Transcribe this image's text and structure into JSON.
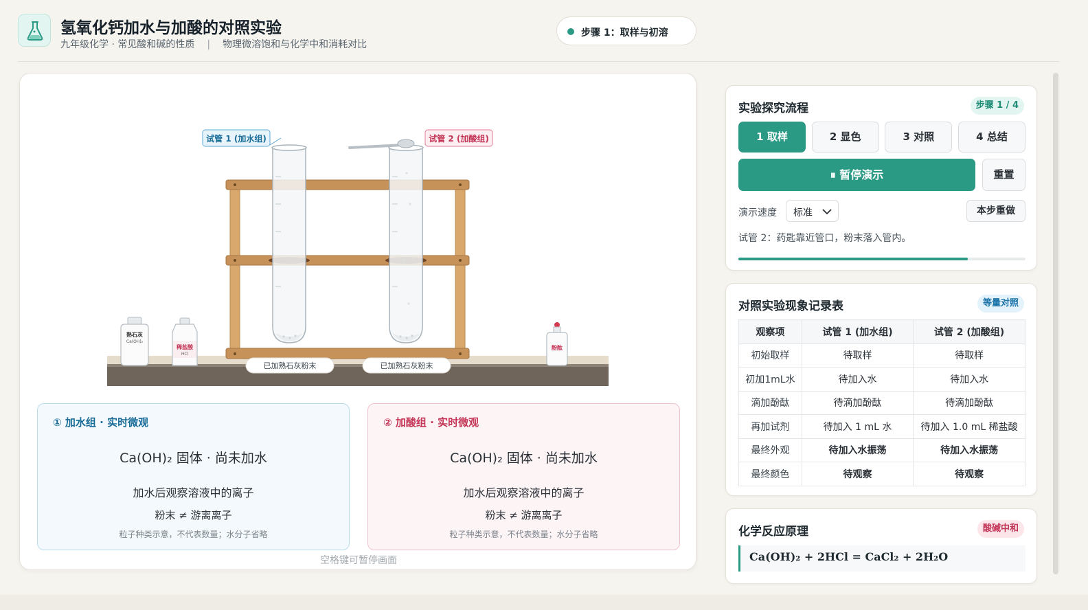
{
  "header": {
    "title": "氢氧化钙加水与加酸的对照实验",
    "subtitle_left": "九年级化学 · 常见酸和碱的性质",
    "subtitle_sep": "|",
    "subtitle_right": "物理微溶饱和与化学中和消耗对比",
    "step_pill": "步骤 1：取样与初溶",
    "icon": "flask-icon"
  },
  "stage": {
    "tube1_label": "试管 1 (加水组)",
    "tube2_label": "试管 2 (加酸组)",
    "tube1_tag": "已加熟石灰粉末",
    "tube2_tag": "已加熟石灰粉末",
    "bottle_lime_name": "熟石灰",
    "bottle_lime_formula": "Ca(OH)₂",
    "bottle_acid_name": "稀盐酸",
    "bottle_acid_formula": "HCl",
    "bottle_phenol_name": "酚酞",
    "hint": "空格键可暂停画面"
  },
  "obs_water": {
    "head": "① 加水组 · 实时微观",
    "line1": "Ca(OH)₂ 固体 · 尚未加水",
    "line2": "加水后观察溶液中的离子",
    "line3": "粉末 ≠ 游离离子",
    "note": "粒子种类示意，不代表数量；水分子省略"
  },
  "obs_acid": {
    "head": "② 加酸组 · 实时微观",
    "line1": "Ca(OH)₂ 固体 · 尚未加水",
    "line2": "加水后观察溶液中的离子",
    "line3": "粉末 ≠ 游离离子",
    "note": "粒子种类示意，不代表数量；水分子省略"
  },
  "flow": {
    "title": "实验探究流程",
    "badge": "步骤 1 / 4",
    "steps": [
      "1 取样",
      "2 显色",
      "3 对照",
      "4 总结"
    ],
    "active_step": 0,
    "pause_label": "⏸ 暂停演示",
    "reset_label": "重置",
    "speed_label": "演示速度",
    "speed_value": "标准",
    "redo_label": "本步重做",
    "status": "试管 2：药匙靠近管口，粉末落入管内。",
    "progress": 0.8
  },
  "record": {
    "title": "对照实验现象记录表",
    "badge": "等量对照",
    "columns": [
      "观察项",
      "试管 1 (加水组)",
      "试管 2 (加酸组)"
    ],
    "rows": [
      [
        "初始取样",
        "待取样",
        "待取样"
      ],
      [
        "初加1mL水",
        "待加入水",
        "待加入水"
      ],
      [
        "滴加酚酞",
        "待滴加酚酞",
        "待滴加酚酞"
      ],
      [
        "再加试剂",
        "待加入 1 mL 水",
        "待加入 1.0 mL 稀盐酸"
      ],
      [
        "最终外观",
        "待加入水振荡",
        "待加入水振荡"
      ],
      [
        "最终颜色",
        "待观察",
        "待观察"
      ]
    ]
  },
  "principle": {
    "title": "化学反应原理",
    "badge": "酸碱中和",
    "formula": "Ca(OH)₂ + 2HCl = CaCl₂ + 2H₂O"
  },
  "colors": {
    "accent": "#2a9a85",
    "water": "#1a6d99",
    "acid": "#c43657",
    "background": "#f6f4ef"
  }
}
